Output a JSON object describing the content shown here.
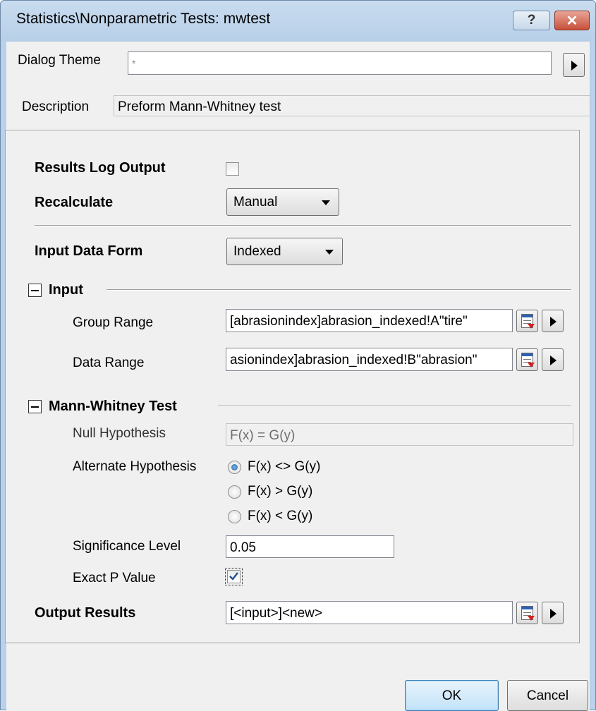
{
  "window": {
    "title": "Statistics\\Nonparametric Tests: mwtest",
    "help_label": "?",
    "close_label": "✕"
  },
  "header": {
    "theme_label": "Dialog Theme",
    "theme_value": "*",
    "description_label": "Description",
    "description_value": "Preform Mann-Whitney test"
  },
  "options": {
    "results_log_label": "Results Log Output",
    "results_log_checked": false,
    "recalculate_label": "Recalculate",
    "recalculate_value": "Manual",
    "input_form_label": "Input Data Form",
    "input_form_value": "Indexed"
  },
  "input": {
    "section_label": "Input",
    "group_range_label": "Group Range",
    "group_range_value": "[abrasionindex]abrasion_indexed!A\"tire\"",
    "data_range_label": "Data Range",
    "data_range_value": "asionindex]abrasion_indexed!B\"abrasion\""
  },
  "test": {
    "section_label": "Mann-Whitney Test",
    "null_label": "Null Hypothesis",
    "null_value": "F(x) = G(y)",
    "alt_label": "Alternate Hypothesis",
    "alt_options": [
      "F(x) <> G(y)",
      "F(x) > G(y)",
      "F(x) < G(y)"
    ],
    "alt_selected": 0,
    "sig_label": "Significance Level",
    "sig_value": "0.05",
    "exact_label": "Exact P Value",
    "exact_checked": true
  },
  "output": {
    "label": "Output Results",
    "value": "[<input>]<new>"
  },
  "footer": {
    "ok_label": "OK",
    "cancel_label": "Cancel"
  },
  "colors": {
    "title_bar": "#b9d1ea",
    "close_button": "#c7503a",
    "dialog_bg": "#f0f0f0",
    "check_mark": "#1c4f8f"
  }
}
